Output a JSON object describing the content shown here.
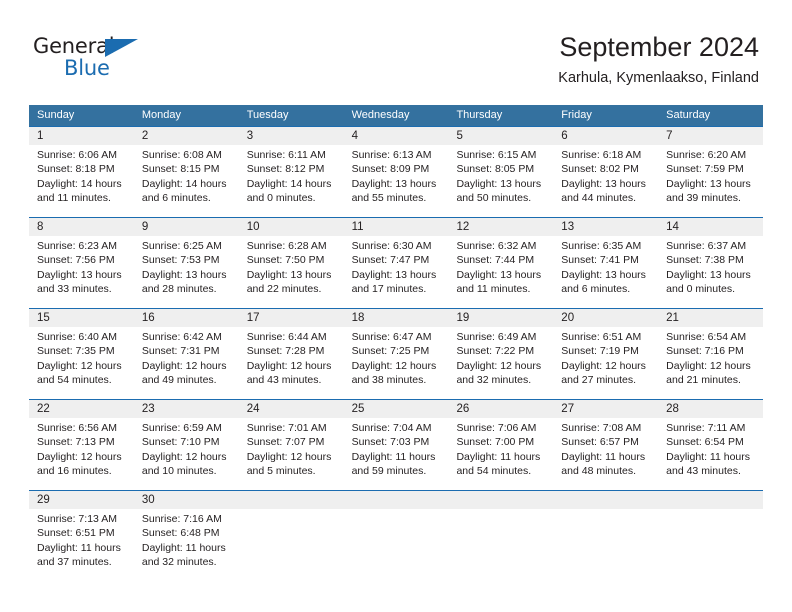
{
  "brand": {
    "name_part1": "General",
    "name_part2": "Blue",
    "triangle_icon": "blue-triangle-logo-mark",
    "color_dark": "#231f20",
    "color_blue": "#1b6cb0"
  },
  "header": {
    "title": "September 2024",
    "subtitle": "Karhula, Kymenlaakso, Finland"
  },
  "theme": {
    "header_row_bg": "#34719f",
    "week_divider": "#1b6cb0",
    "daynum_band_bg": "#efefef",
    "text": "#231f20"
  },
  "weekdays": [
    "Sunday",
    "Monday",
    "Tuesday",
    "Wednesday",
    "Thursday",
    "Friday",
    "Saturday"
  ],
  "weeks": [
    {
      "days": [
        {
          "number": "1",
          "sunrise": "Sunrise: 6:06 AM",
          "sunset": "Sunset: 8:18 PM",
          "daylight_line1": "Daylight: 14 hours",
          "daylight_line2": "and 11 minutes."
        },
        {
          "number": "2",
          "sunrise": "Sunrise: 6:08 AM",
          "sunset": "Sunset: 8:15 PM",
          "daylight_line1": "Daylight: 14 hours",
          "daylight_line2": "and 6 minutes."
        },
        {
          "number": "3",
          "sunrise": "Sunrise: 6:11 AM",
          "sunset": "Sunset: 8:12 PM",
          "daylight_line1": "Daylight: 14 hours",
          "daylight_line2": "and 0 minutes."
        },
        {
          "number": "4",
          "sunrise": "Sunrise: 6:13 AM",
          "sunset": "Sunset: 8:09 PM",
          "daylight_line1": "Daylight: 13 hours",
          "daylight_line2": "and 55 minutes."
        },
        {
          "number": "5",
          "sunrise": "Sunrise: 6:15 AM",
          "sunset": "Sunset: 8:05 PM",
          "daylight_line1": "Daylight: 13 hours",
          "daylight_line2": "and 50 minutes."
        },
        {
          "number": "6",
          "sunrise": "Sunrise: 6:18 AM",
          "sunset": "Sunset: 8:02 PM",
          "daylight_line1": "Daylight: 13 hours",
          "daylight_line2": "and 44 minutes."
        },
        {
          "number": "7",
          "sunrise": "Sunrise: 6:20 AM",
          "sunset": "Sunset: 7:59 PM",
          "daylight_line1": "Daylight: 13 hours",
          "daylight_line2": "and 39 minutes."
        }
      ]
    },
    {
      "days": [
        {
          "number": "8",
          "sunrise": "Sunrise: 6:23 AM",
          "sunset": "Sunset: 7:56 PM",
          "daylight_line1": "Daylight: 13 hours",
          "daylight_line2": "and 33 minutes."
        },
        {
          "number": "9",
          "sunrise": "Sunrise: 6:25 AM",
          "sunset": "Sunset: 7:53 PM",
          "daylight_line1": "Daylight: 13 hours",
          "daylight_line2": "and 28 minutes."
        },
        {
          "number": "10",
          "sunrise": "Sunrise: 6:28 AM",
          "sunset": "Sunset: 7:50 PM",
          "daylight_line1": "Daylight: 13 hours",
          "daylight_line2": "and 22 minutes."
        },
        {
          "number": "11",
          "sunrise": "Sunrise: 6:30 AM",
          "sunset": "Sunset: 7:47 PM",
          "daylight_line1": "Daylight: 13 hours",
          "daylight_line2": "and 17 minutes."
        },
        {
          "number": "12",
          "sunrise": "Sunrise: 6:32 AM",
          "sunset": "Sunset: 7:44 PM",
          "daylight_line1": "Daylight: 13 hours",
          "daylight_line2": "and 11 minutes."
        },
        {
          "number": "13",
          "sunrise": "Sunrise: 6:35 AM",
          "sunset": "Sunset: 7:41 PM",
          "daylight_line1": "Daylight: 13 hours",
          "daylight_line2": "and 6 minutes."
        },
        {
          "number": "14",
          "sunrise": "Sunrise: 6:37 AM",
          "sunset": "Sunset: 7:38 PM",
          "daylight_line1": "Daylight: 13 hours",
          "daylight_line2": "and 0 minutes."
        }
      ]
    },
    {
      "days": [
        {
          "number": "15",
          "sunrise": "Sunrise: 6:40 AM",
          "sunset": "Sunset: 7:35 PM",
          "daylight_line1": "Daylight: 12 hours",
          "daylight_line2": "and 54 minutes."
        },
        {
          "number": "16",
          "sunrise": "Sunrise: 6:42 AM",
          "sunset": "Sunset: 7:31 PM",
          "daylight_line1": "Daylight: 12 hours",
          "daylight_line2": "and 49 minutes."
        },
        {
          "number": "17",
          "sunrise": "Sunrise: 6:44 AM",
          "sunset": "Sunset: 7:28 PM",
          "daylight_line1": "Daylight: 12 hours",
          "daylight_line2": "and 43 minutes."
        },
        {
          "number": "18",
          "sunrise": "Sunrise: 6:47 AM",
          "sunset": "Sunset: 7:25 PM",
          "daylight_line1": "Daylight: 12 hours",
          "daylight_line2": "and 38 minutes."
        },
        {
          "number": "19",
          "sunrise": "Sunrise: 6:49 AM",
          "sunset": "Sunset: 7:22 PM",
          "daylight_line1": "Daylight: 12 hours",
          "daylight_line2": "and 32 minutes."
        },
        {
          "number": "20",
          "sunrise": "Sunrise: 6:51 AM",
          "sunset": "Sunset: 7:19 PM",
          "daylight_line1": "Daylight: 12 hours",
          "daylight_line2": "and 27 minutes."
        },
        {
          "number": "21",
          "sunrise": "Sunrise: 6:54 AM",
          "sunset": "Sunset: 7:16 PM",
          "daylight_line1": "Daylight: 12 hours",
          "daylight_line2": "and 21 minutes."
        }
      ]
    },
    {
      "days": [
        {
          "number": "22",
          "sunrise": "Sunrise: 6:56 AM",
          "sunset": "Sunset: 7:13 PM",
          "daylight_line1": "Daylight: 12 hours",
          "daylight_line2": "and 16 minutes."
        },
        {
          "number": "23",
          "sunrise": "Sunrise: 6:59 AM",
          "sunset": "Sunset: 7:10 PM",
          "daylight_line1": "Daylight: 12 hours",
          "daylight_line2": "and 10 minutes."
        },
        {
          "number": "24",
          "sunrise": "Sunrise: 7:01 AM",
          "sunset": "Sunset: 7:07 PM",
          "daylight_line1": "Daylight: 12 hours",
          "daylight_line2": "and 5 minutes."
        },
        {
          "number": "25",
          "sunrise": "Sunrise: 7:04 AM",
          "sunset": "Sunset: 7:03 PM",
          "daylight_line1": "Daylight: 11 hours",
          "daylight_line2": "and 59 minutes."
        },
        {
          "number": "26",
          "sunrise": "Sunrise: 7:06 AM",
          "sunset": "Sunset: 7:00 PM",
          "daylight_line1": "Daylight: 11 hours",
          "daylight_line2": "and 54 minutes."
        },
        {
          "number": "27",
          "sunrise": "Sunrise: 7:08 AM",
          "sunset": "Sunset: 6:57 PM",
          "daylight_line1": "Daylight: 11 hours",
          "daylight_line2": "and 48 minutes."
        },
        {
          "number": "28",
          "sunrise": "Sunrise: 7:11 AM",
          "sunset": "Sunset: 6:54 PM",
          "daylight_line1": "Daylight: 11 hours",
          "daylight_line2": "and 43 minutes."
        }
      ]
    },
    {
      "days": [
        {
          "number": "29",
          "sunrise": "Sunrise: 7:13 AM",
          "sunset": "Sunset: 6:51 PM",
          "daylight_line1": "Daylight: 11 hours",
          "daylight_line2": "and 37 minutes."
        },
        {
          "number": "30",
          "sunrise": "Sunrise: 7:16 AM",
          "sunset": "Sunset: 6:48 PM",
          "daylight_line1": "Daylight: 11 hours",
          "daylight_line2": "and 32 minutes."
        },
        {
          "number": "",
          "sunrise": "",
          "sunset": "",
          "daylight_line1": "",
          "daylight_line2": ""
        },
        {
          "number": "",
          "sunrise": "",
          "sunset": "",
          "daylight_line1": "",
          "daylight_line2": ""
        },
        {
          "number": "",
          "sunrise": "",
          "sunset": "",
          "daylight_line1": "",
          "daylight_line2": ""
        },
        {
          "number": "",
          "sunrise": "",
          "sunset": "",
          "daylight_line1": "",
          "daylight_line2": ""
        },
        {
          "number": "",
          "sunrise": "",
          "sunset": "",
          "daylight_line1": "",
          "daylight_line2": ""
        }
      ]
    }
  ]
}
